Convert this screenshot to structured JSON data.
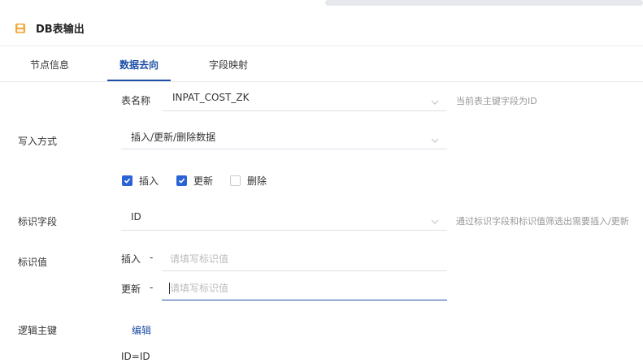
{
  "header": {
    "title": "DB表输出",
    "icon": "db-output-icon"
  },
  "tabs": [
    {
      "label": "节点信息"
    },
    {
      "label": "数据去向"
    },
    {
      "label": "字段映射"
    }
  ],
  "active_tab": "数据去向",
  "form": {
    "table": {
      "label": "表名称",
      "value": "INPAT_COST_ZK",
      "hint": "当前表主键字段为ID"
    },
    "write_mode": {
      "label": "写入方式",
      "value": "插入/更新/删除数据"
    },
    "operations": [
      {
        "label": "插入",
        "checked": true
      },
      {
        "label": "更新",
        "checked": true
      },
      {
        "label": "删除",
        "checked": false
      }
    ],
    "id_field": {
      "label": "标识字段",
      "value": "ID",
      "hint": "通过标识字段和标识值筛选出需要插入/更新"
    },
    "id_value": {
      "label": "标识值",
      "insert": {
        "label": "插入",
        "dash": "-",
        "placeholder": "请填写标识值"
      },
      "update": {
        "label": "更新",
        "dash": "-",
        "placeholder": "请填写标识值"
      }
    },
    "logic_key": {
      "label": "逻辑主键",
      "edit_label": "编辑",
      "value": "ID=ID"
    }
  },
  "colors": {
    "accent": "#1f4fa8",
    "checkbox": "#2b62d6",
    "icon": "#f0a93b"
  }
}
